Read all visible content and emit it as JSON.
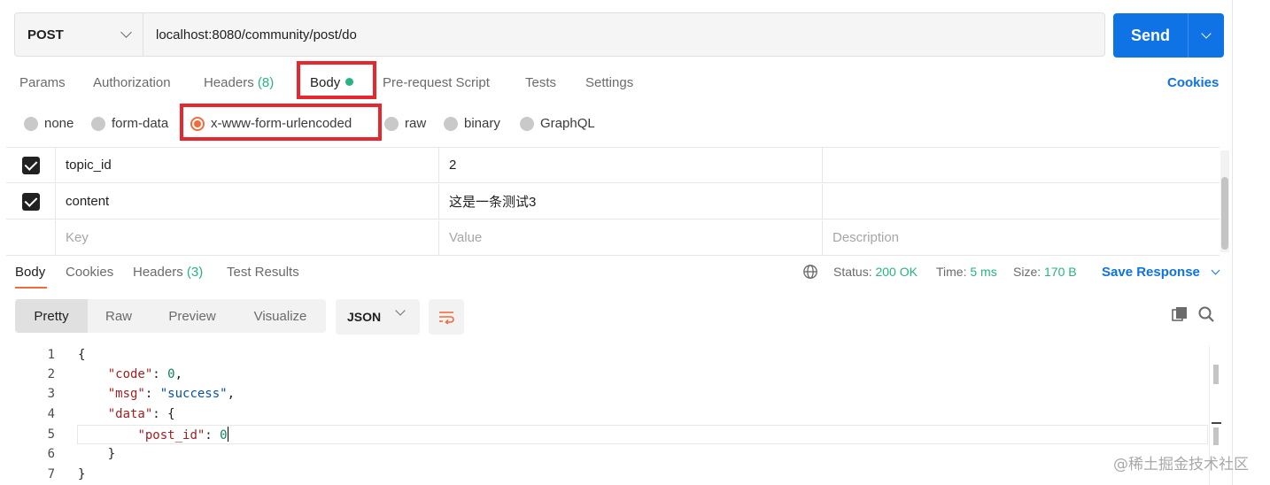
{
  "request": {
    "method": "POST",
    "url": "localhost:8080/community/post/do",
    "send_label": "Send"
  },
  "request_tabs": [
    {
      "label": "Params"
    },
    {
      "label": "Authorization"
    },
    {
      "label": "Headers",
      "count": "(8)"
    },
    {
      "label": "Body"
    },
    {
      "label": "Pre-request Script"
    },
    {
      "label": "Tests"
    },
    {
      "label": "Settings"
    }
  ],
  "cookies_label": "Cookies",
  "body_types": [
    "none",
    "form-data",
    "x-www-form-urlencoded",
    "raw",
    "binary",
    "GraphQL"
  ],
  "body_type_selected": "x-www-form-urlencoded",
  "params": [
    {
      "key": "topic_id",
      "value": "2",
      "description": ""
    },
    {
      "key": "content",
      "value": "这是一条测试3",
      "description": ""
    }
  ],
  "params_placeholder": {
    "key": "Key",
    "value": "Value",
    "description": "Description"
  },
  "response_tabs": [
    {
      "label": "Body"
    },
    {
      "label": "Cookies"
    },
    {
      "label": "Headers",
      "count": "(3)"
    },
    {
      "label": "Test Results"
    }
  ],
  "response_status": {
    "status_label": "Status:",
    "status_value": "200 OK",
    "time_label": "Time:",
    "time_value": "5 ms",
    "size_label": "Size:",
    "size_value": "170 B"
  },
  "save_response_label": "Save Response",
  "view_modes": [
    "Pretty",
    "Raw",
    "Preview",
    "Visualize"
  ],
  "format": "JSON",
  "code_lines": {
    "l1": {
      "num": "1"
    },
    "l2": {
      "num": "2",
      "key": "\"code\"",
      "value": "0"
    },
    "l3": {
      "num": "3",
      "key": "\"msg\"",
      "value": "\"success\""
    },
    "l4": {
      "num": "4",
      "key": "\"data\""
    },
    "l5": {
      "num": "5",
      "key": "\"post_id\"",
      "value": "0"
    },
    "l6": {
      "num": "6"
    },
    "l7": {
      "num": "7"
    }
  },
  "watermark": "@稀土掘金技术社区",
  "colors": {
    "accent_blue": "#0f72e5",
    "status_green": "#26b47f",
    "highlight_red": "#e8262e",
    "radio_orange": "#f26b3a"
  }
}
